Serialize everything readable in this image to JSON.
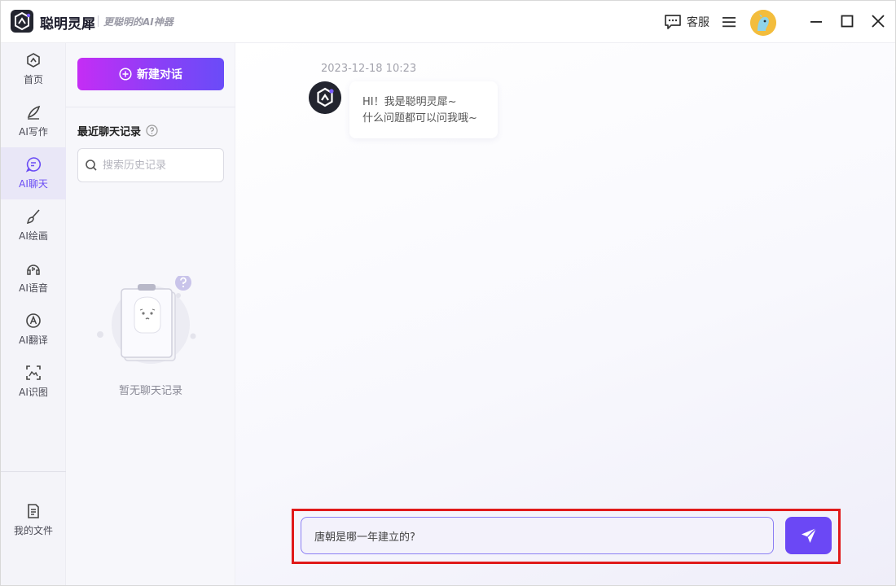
{
  "app": {
    "name": "聪明灵犀",
    "slogan": "更聪明的AI神器",
    "logo_icon": "logo-icon"
  },
  "titlebar": {
    "service_label": "客服",
    "service_icon": "chat-bubble-icon",
    "menu_icon": "hamburger-menu-icon",
    "avatar_icon": "user-avatar-icon",
    "window_controls": [
      "minimize-icon",
      "maximize-icon",
      "close-icon"
    ]
  },
  "sidebar": {
    "items": [
      {
        "label": "首页",
        "icon": "home-icon",
        "active": false
      },
      {
        "label": "AI写作",
        "icon": "pen-icon",
        "active": false
      },
      {
        "label": "AI聊天",
        "icon": "chat-icon",
        "active": true
      },
      {
        "label": "AI绘画",
        "icon": "brush-icon",
        "active": false
      },
      {
        "label": "AI语音",
        "icon": "voice-icon",
        "active": false
      },
      {
        "label": "AI翻译",
        "icon": "translate-icon",
        "active": false
      },
      {
        "label": "AI识图",
        "icon": "image-recognition-icon",
        "active": false
      }
    ],
    "bottom_item": {
      "label": "我的文件",
      "icon": "file-icon"
    }
  },
  "history": {
    "new_chat_label": "新建对话",
    "recent_title": "最近聊天记录",
    "search_placeholder": "搜索历史记录",
    "empty_text": "暂无聊天记录"
  },
  "chat": {
    "timestamp": "2023-12-18 10:23",
    "bot_message_lines": [
      "HI！我是聪明灵犀~",
      "什么问题都可以问我哦~"
    ],
    "input_value": "唐朝是哪一年建立的?"
  },
  "colors": {
    "accent": "#6b48f5",
    "gradient_start": "#c52df5",
    "gradient_end": "#6a4cf8",
    "highlight": "#e01a1a"
  }
}
